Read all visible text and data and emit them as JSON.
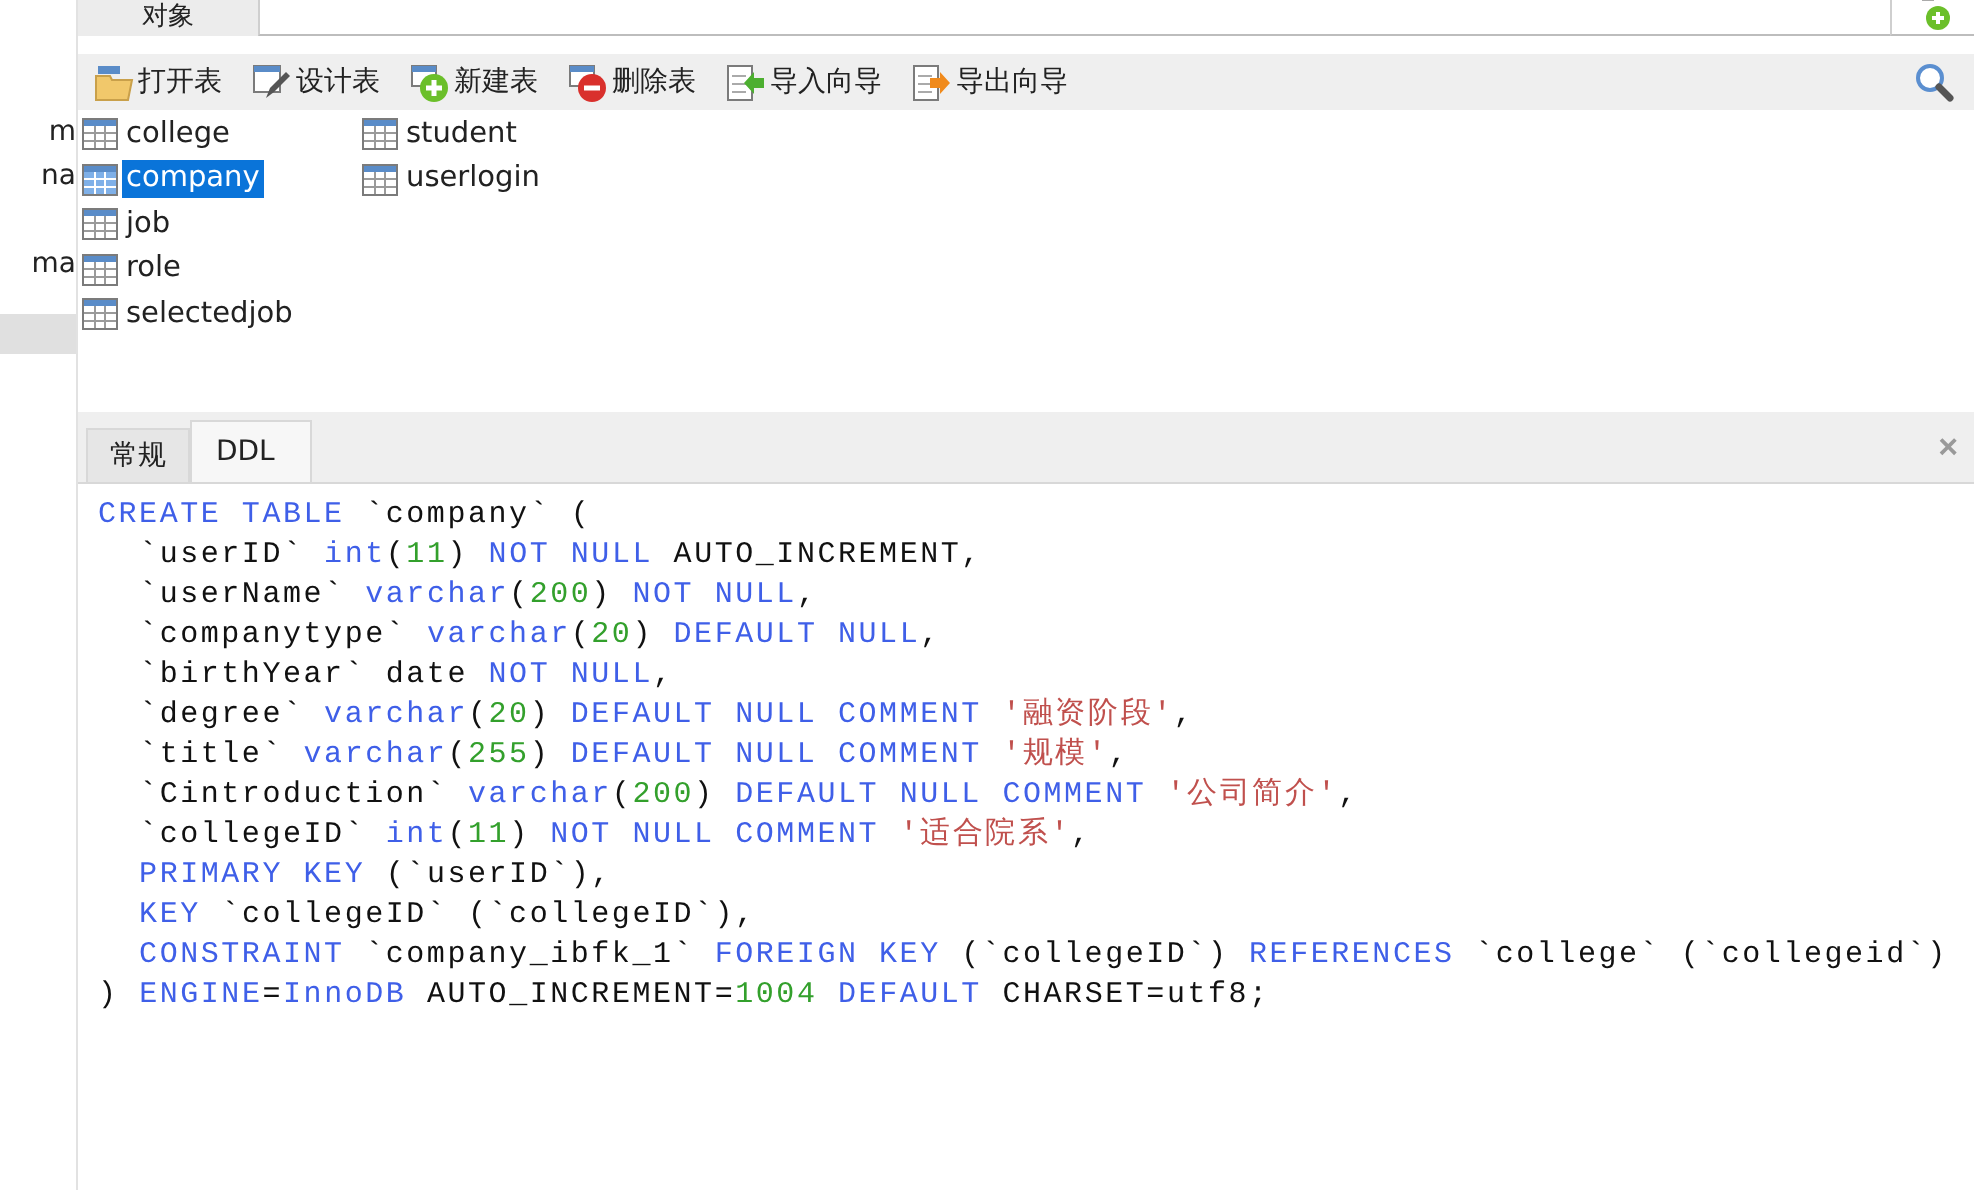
{
  "sidebar": {
    "items": [
      {
        "label": "m"
      },
      {
        "label": "na"
      },
      {
        "label": "ma"
      }
    ]
  },
  "top_tab": {
    "label": "对象"
  },
  "toolbar": {
    "buttons": [
      {
        "kind": "open",
        "label": "打开表"
      },
      {
        "kind": "design",
        "label": "设计表"
      },
      {
        "kind": "new",
        "label": "新建表"
      },
      {
        "kind": "delete",
        "label": "删除表"
      },
      {
        "kind": "import",
        "label": "导入向导"
      },
      {
        "kind": "export",
        "label": "导出向导"
      }
    ]
  },
  "tables": [
    {
      "name": "college",
      "selected": false
    },
    {
      "name": "company",
      "selected": true
    },
    {
      "name": "job",
      "selected": false
    },
    {
      "name": "role",
      "selected": false
    },
    {
      "name": "selectedjob",
      "selected": false
    },
    {
      "name": "student",
      "selected": false
    },
    {
      "name": "userlogin",
      "selected": false
    }
  ],
  "info_tabs": [
    {
      "label": "常规",
      "selected": false
    },
    {
      "label": "DDL",
      "selected": true
    }
  ],
  "close_label": "×",
  "ddl": {
    "lines": [
      [
        {
          "kind": "kw",
          "text": "CREATE TABLE"
        },
        {
          "kind": "plain",
          "text": " `company` ("
        }
      ],
      [
        {
          "kind": "plain",
          "text": "  `userID` "
        },
        {
          "kind": "kw",
          "text": "int"
        },
        {
          "kind": "plain",
          "text": "("
        },
        {
          "kind": "num",
          "text": "11"
        },
        {
          "kind": "plain",
          "text": ") "
        },
        {
          "kind": "kw",
          "text": "NOT NULL"
        },
        {
          "kind": "plain",
          "text": " AUTO_INCREMENT,"
        }
      ],
      [
        {
          "kind": "plain",
          "text": "  `userName` "
        },
        {
          "kind": "kw",
          "text": "varchar"
        },
        {
          "kind": "plain",
          "text": "("
        },
        {
          "kind": "num",
          "text": "200"
        },
        {
          "kind": "plain",
          "text": ") "
        },
        {
          "kind": "kw",
          "text": "NOT NULL"
        },
        {
          "kind": "plain",
          "text": ","
        }
      ],
      [
        {
          "kind": "plain",
          "text": "  `companytype` "
        },
        {
          "kind": "kw",
          "text": "varchar"
        },
        {
          "kind": "plain",
          "text": "("
        },
        {
          "kind": "num",
          "text": "20"
        },
        {
          "kind": "plain",
          "text": ") "
        },
        {
          "kind": "kw",
          "text": "DEFAULT NULL"
        },
        {
          "kind": "plain",
          "text": ","
        }
      ],
      [
        {
          "kind": "plain",
          "text": "  `birthYear` date "
        },
        {
          "kind": "kw",
          "text": "NOT NULL"
        },
        {
          "kind": "plain",
          "text": ","
        }
      ],
      [
        {
          "kind": "plain",
          "text": "  `degree` "
        },
        {
          "kind": "kw",
          "text": "varchar"
        },
        {
          "kind": "plain",
          "text": "("
        },
        {
          "kind": "num",
          "text": "20"
        },
        {
          "kind": "plain",
          "text": ") "
        },
        {
          "kind": "kw",
          "text": "DEFAULT NULL COMMENT"
        },
        {
          "kind": "str",
          "text": " '融资阶段'"
        },
        {
          "kind": "plain",
          "text": ","
        }
      ],
      [
        {
          "kind": "plain",
          "text": "  `title` "
        },
        {
          "kind": "kw",
          "text": "varchar"
        },
        {
          "kind": "plain",
          "text": "("
        },
        {
          "kind": "num",
          "text": "255"
        },
        {
          "kind": "plain",
          "text": ") "
        },
        {
          "kind": "kw",
          "text": "DEFAULT NULL COMMENT"
        },
        {
          "kind": "str",
          "text": " '规模'"
        },
        {
          "kind": "plain",
          "text": ","
        }
      ],
      [
        {
          "kind": "plain",
          "text": "  `Cintroduction` "
        },
        {
          "kind": "kw",
          "text": "varchar"
        },
        {
          "kind": "plain",
          "text": "("
        },
        {
          "kind": "num",
          "text": "200"
        },
        {
          "kind": "plain",
          "text": ") "
        },
        {
          "kind": "kw",
          "text": "DEFAULT NULL COMMENT"
        },
        {
          "kind": "str",
          "text": " '公司简介'"
        },
        {
          "kind": "plain",
          "text": ","
        }
      ],
      [
        {
          "kind": "plain",
          "text": "  `collegeID` "
        },
        {
          "kind": "kw",
          "text": "int"
        },
        {
          "kind": "plain",
          "text": "("
        },
        {
          "kind": "num",
          "text": "11"
        },
        {
          "kind": "plain",
          "text": ") "
        },
        {
          "kind": "kw",
          "text": "NOT NULL COMMENT"
        },
        {
          "kind": "str",
          "text": " '适合院系'"
        },
        {
          "kind": "plain",
          "text": ","
        }
      ],
      [
        {
          "kind": "kw",
          "text": "  PRIMARY KEY"
        },
        {
          "kind": "plain",
          "text": " (`userID`),"
        }
      ],
      [
        {
          "kind": "kw",
          "text": "  KEY"
        },
        {
          "kind": "plain",
          "text": " `collegeID` (`collegeID`),"
        }
      ],
      [
        {
          "kind": "kw",
          "text": "  CONSTRAINT"
        },
        {
          "kind": "plain",
          "text": " `company_ibfk_1` "
        },
        {
          "kind": "kw",
          "text": "FOREIGN KEY"
        },
        {
          "kind": "plain",
          "text": " (`collegeID`) "
        },
        {
          "kind": "kw",
          "text": "REFERENCES"
        },
        {
          "kind": "plain",
          "text": " `college` (`collegeid`)"
        }
      ],
      [
        {
          "kind": "plain",
          "text": ") "
        },
        {
          "kind": "kw",
          "text": "ENGINE"
        },
        {
          "kind": "plain",
          "text": "="
        },
        {
          "kind": "kw",
          "text": "InnoDB"
        },
        {
          "kind": "plain",
          "text": " AUTO_INCREMENT="
        },
        {
          "kind": "num",
          "text": "1004"
        },
        {
          "kind": "kw",
          "text": " DEFAULT"
        },
        {
          "kind": "plain",
          "text": " CHARSET=utf8;"
        }
      ]
    ]
  }
}
